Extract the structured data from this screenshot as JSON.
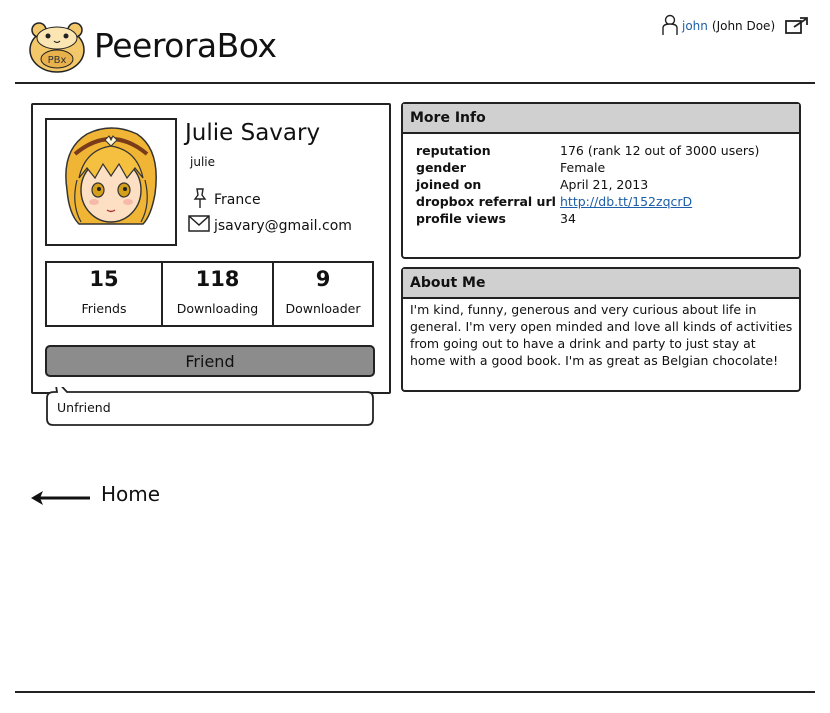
{
  "header": {
    "app_title": "PeeroraBox",
    "logo_text": "PBx",
    "user": {
      "username": "john",
      "fullname": "(John Doe)"
    }
  },
  "profile": {
    "name": "Julie Savary",
    "username": "julie",
    "location": "France",
    "email": "jsavary@gmail.com",
    "stats": [
      {
        "value": "15",
        "label": "Friends"
      },
      {
        "value": "118",
        "label": "Downloading"
      },
      {
        "value": "9",
        "label": "Downloader"
      }
    ],
    "friend_button": "Friend",
    "menu_item_unfriend": "Unfriend"
  },
  "more_info": {
    "title": "More Info",
    "rows": [
      {
        "key": "reputation",
        "value": "176 (rank 12 out of 3000 users)"
      },
      {
        "key": "gender",
        "value": "Female"
      },
      {
        "key": "joined on",
        "value": "April 21, 2013"
      },
      {
        "key": "dropbox referral url",
        "value": "http://db.tt/152zqcrD"
      },
      {
        "key": "profile views",
        "value": "34"
      }
    ]
  },
  "about_me": {
    "title": "About Me",
    "text": "I'm kind, funny, generous and very curious about life in general. I'm very open minded and love all kinds of activities from going out to have a drink and party to just stay at home with a good book. I'm as great as Belgian chocolate!"
  },
  "nav": {
    "home_label": "Home"
  }
}
